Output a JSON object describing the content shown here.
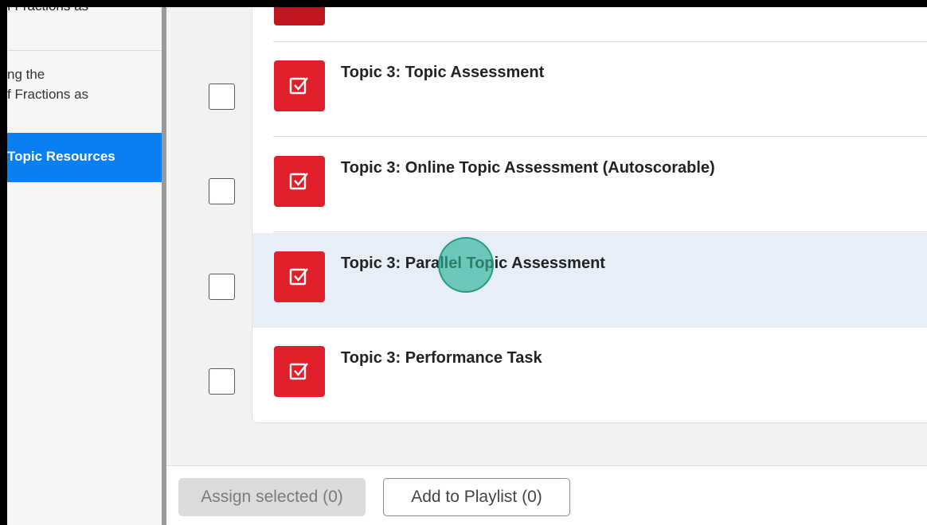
{
  "sidebar": {
    "items": [
      {
        "lines": [
          "f Fractions as"
        ]
      },
      {
        "lines": [
          "ng the",
          "f Fractions as"
        ]
      },
      {
        "lines": [
          "Topic Resources"
        ]
      }
    ]
  },
  "resources": [
    {
      "title": "Topic 3: Topic Assessment",
      "icon": "assessment-check-icon"
    },
    {
      "title": "Topic 3: Online Topic Assessment (Autoscorable)",
      "icon": "assessment-check-icon"
    },
    {
      "title": "Topic 3: Parallel Topic Assessment",
      "icon": "assessment-check-icon"
    },
    {
      "title": "Topic 3: Performance Task",
      "icon": "assessment-check-icon"
    }
  ],
  "footer": {
    "assign_label": "Assign selected (0)",
    "playlist_label": "Add to Playlist (0)"
  },
  "colors": {
    "active_nav": "#0a7ff2",
    "assessment_badge": "#e11f2b",
    "row_highlight": "#e6eff8",
    "cursor_indicator": "#2db296"
  }
}
